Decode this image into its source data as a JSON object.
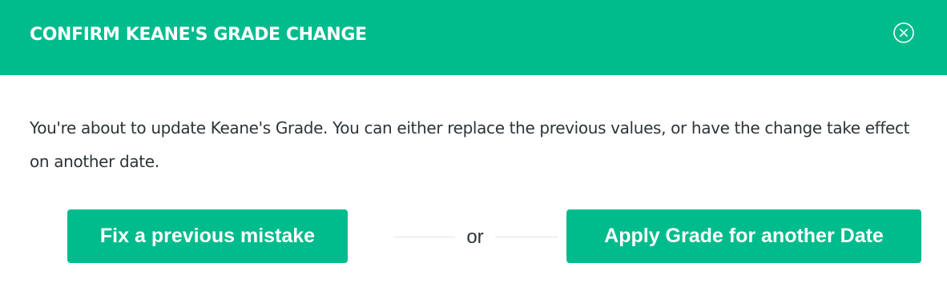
{
  "dialog": {
    "title": "CONFIRM KEANE'S GRADE CHANGE",
    "close_icon": "close-circle-icon",
    "message": "You're about to update Keane's Grade. You can either replace the previous values, or have the change take effect on another date."
  },
  "actions": {
    "fix_label": "Fix a previous mistake",
    "separator_label": "or",
    "apply_label": "Apply Grade for another Date"
  },
  "colors": {
    "accent": "#00bc8c",
    "header_text": "#ffffff",
    "body_text": "#2d3438",
    "divider": "#dfe3e6"
  }
}
